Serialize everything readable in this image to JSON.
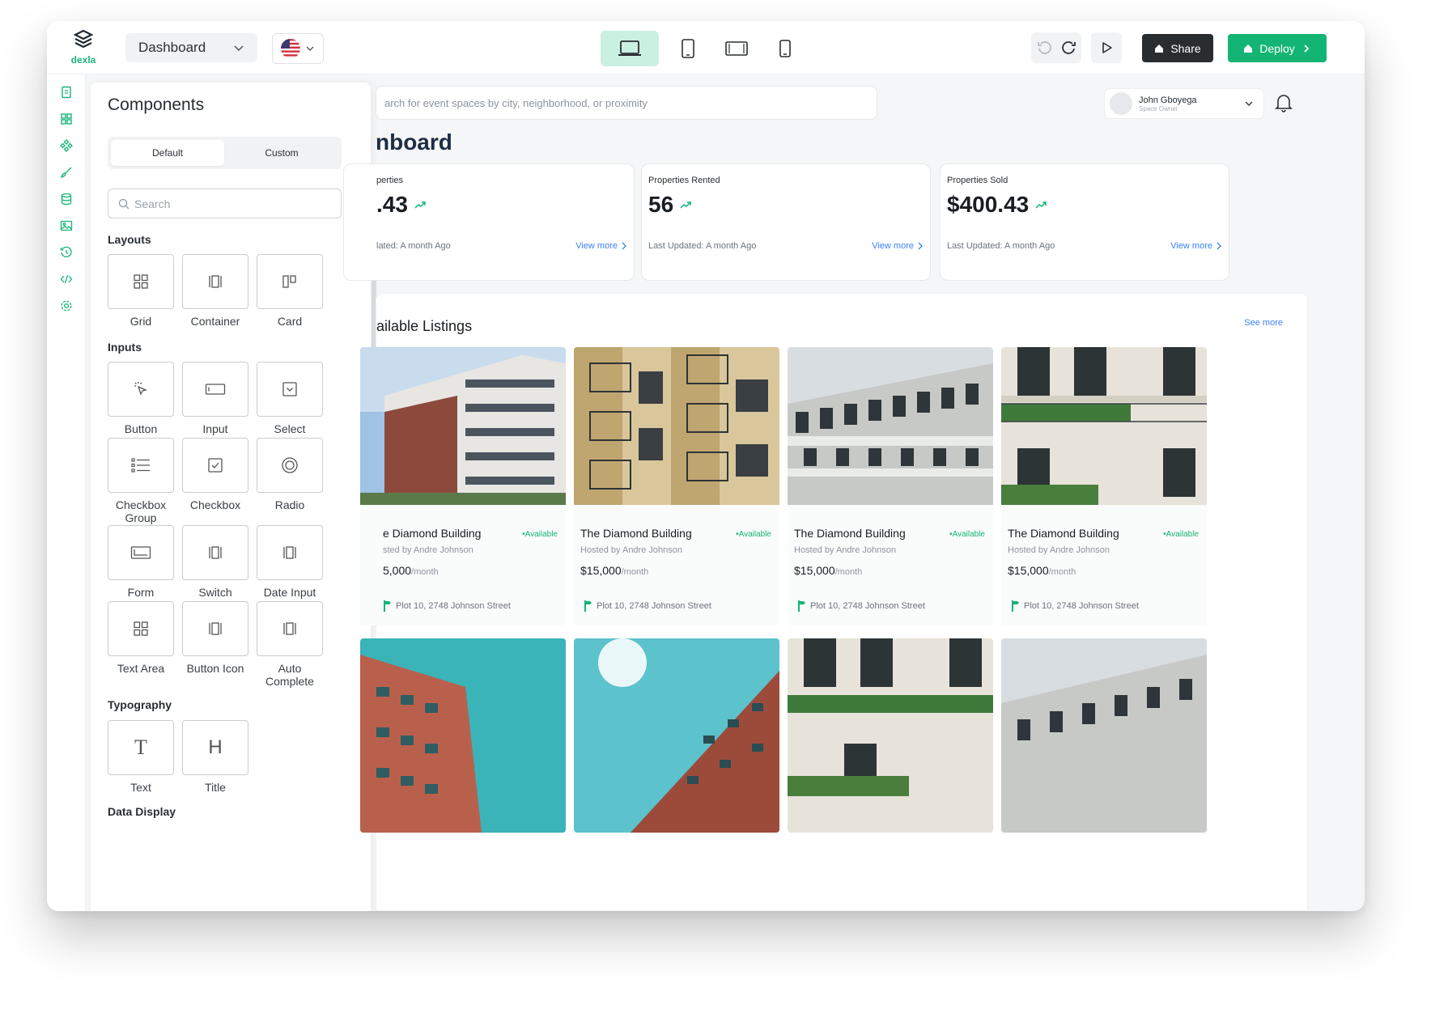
{
  "topbar": {
    "logo_text": "dexla",
    "page_select": "Dashboard",
    "share_label": "Share",
    "deploy_label": "Deploy"
  },
  "colors": {
    "accent": "#14b574",
    "dark": "#2a2d30",
    "link": "#3b82f6"
  },
  "components": {
    "title": "Components",
    "tabs": [
      "Default",
      "Custom"
    ],
    "search_placeholder": "Search",
    "sections": {
      "layouts": "Layouts",
      "inputs": "Inputs",
      "typography": "Typography",
      "data_display": "Data Display"
    },
    "layouts": [
      "Grid",
      "Container",
      "Card"
    ],
    "inputs": [
      "Button",
      "Input",
      "Select",
      "Checkbox Group",
      "Checkbox",
      "Radio",
      "Form",
      "Switch",
      "Date Input",
      "Text Area",
      "Button Icon",
      "Auto Complete"
    ],
    "typography": [
      "Text",
      "Title"
    ]
  },
  "main": {
    "search_placeholder": "arch for event spaces by city, neighborhood, or proximity",
    "user_name": "John Gboyega",
    "user_role": "Space Owner",
    "title": "nboard",
    "stats": [
      {
        "label": "perties",
        "value": ".43",
        "updated": "lated: A month Ago",
        "more": "View more"
      },
      {
        "label": "Properties Rented",
        "value": "56",
        "updated": "Last Updated: A month Ago",
        "more": "View more"
      },
      {
        "label": "Properties Sold",
        "value": "$400.43",
        "updated": "Last Updated: A month Ago",
        "more": "View more"
      }
    ],
    "listings_title": "ailable Listings",
    "see_more": "See more",
    "cards": [
      {
        "name": "e Diamond Building",
        "status": "•Available",
        "host": "sted by Andre Johnson",
        "price": "5,000",
        "unit": "/month",
        "address": "Plot 10, 2748 Johnson Street"
      },
      {
        "name": "The Diamond Building",
        "status": "•Available",
        "host": "Hosted by Andre Johnson",
        "price": "$15,000",
        "unit": "/month",
        "address": "Plot 10, 2748 Johnson Street"
      },
      {
        "name": "The Diamond Building",
        "status": "•Available",
        "host": "Hosted by Andre Johnson",
        "price": "$15,000",
        "unit": "/month",
        "address": "Plot 10, 2748 Johnson Street"
      },
      {
        "name": "The Diamond Building",
        "status": "•Available",
        "host": "Hosted by Andre Johnson",
        "price": "$15,000",
        "unit": "/month",
        "address": "Plot 10, 2748 Johnson Street"
      }
    ]
  }
}
